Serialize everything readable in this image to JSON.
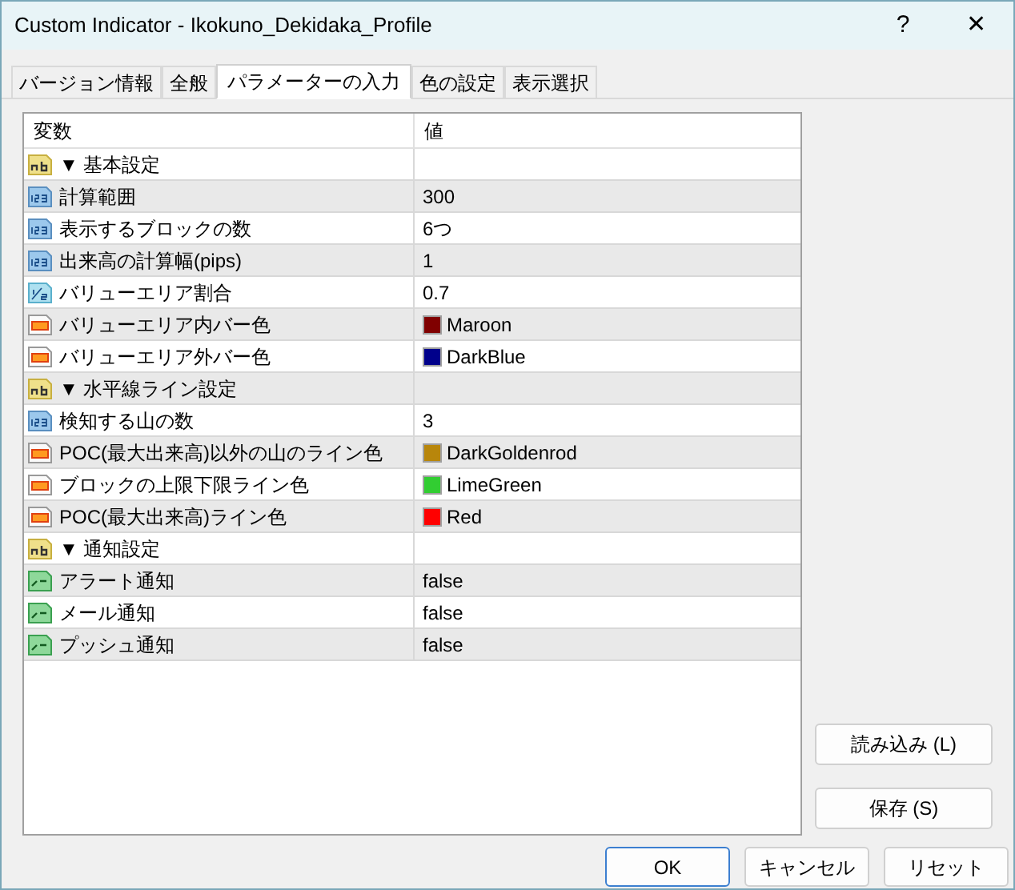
{
  "window": {
    "title": "Custom Indicator - Ikokuno_Dekidaka_Profile",
    "help_button": "?",
    "close_button": "✕"
  },
  "tabs": [
    {
      "label": "バージョン情報",
      "selected": false
    },
    {
      "label": "全般",
      "selected": false
    },
    {
      "label": "パラメーターの入力",
      "selected": true
    },
    {
      "label": "色の設定",
      "selected": false
    },
    {
      "label": "表示選択",
      "selected": false
    }
  ],
  "table": {
    "columns": [
      "変数",
      "値"
    ],
    "rows": [
      {
        "kind": "string",
        "name": "▼ 基本設定"
      },
      {
        "kind": "int",
        "name": "計算範囲",
        "value": "300"
      },
      {
        "kind": "int",
        "name": "表示するブロックの数",
        "value": "6つ"
      },
      {
        "kind": "int",
        "name": "出来高の計算幅(pips)",
        "value": "1"
      },
      {
        "kind": "double",
        "name": "バリューエリア割合",
        "value": "0.7"
      },
      {
        "kind": "color",
        "name": "バリューエリア内バー色",
        "value": "Maroon",
        "color": "#800000"
      },
      {
        "kind": "color",
        "name": "バリューエリア外バー色",
        "value": "DarkBlue",
        "color": "#00008b"
      },
      {
        "kind": "string",
        "name": "▼ 水平線ライン設定"
      },
      {
        "kind": "int",
        "name": "検知する山の数",
        "value": "3"
      },
      {
        "kind": "color",
        "name": "POC(最大出来高)以外の山のライン色",
        "value": "DarkGoldenrod",
        "color": "#b8860b"
      },
      {
        "kind": "color",
        "name": "ブロックの上限下限ライン色",
        "value": "LimeGreen",
        "color": "#32cd32"
      },
      {
        "kind": "color",
        "name": "POC(最大出来高)ライン色",
        "value": "Red",
        "color": "#ff0000"
      },
      {
        "kind": "string",
        "name": "▼ 通知設定"
      },
      {
        "kind": "bool",
        "name": "アラート通知",
        "value": "false"
      },
      {
        "kind": "bool",
        "name": "メール通知",
        "value": "false"
      },
      {
        "kind": "bool",
        "name": "プッシュ通知",
        "value": "false"
      }
    ]
  },
  "side_buttons": [
    "読み込み (L)",
    "保存 (S)"
  ],
  "buttons": [
    "OK",
    "キャンセル",
    "リセット"
  ]
}
